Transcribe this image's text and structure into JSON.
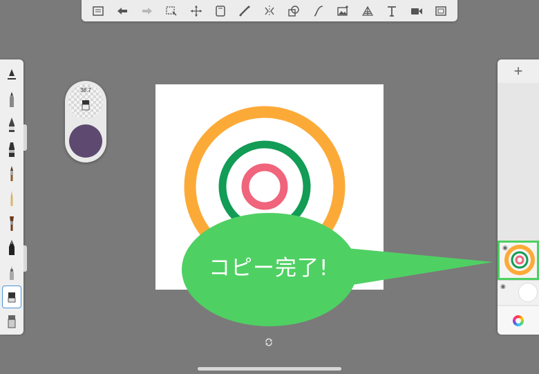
{
  "toolbar": {
    "tools": [
      {
        "name": "gallery-icon",
        "dim": false
      },
      {
        "name": "undo-icon",
        "dim": false
      },
      {
        "name": "redo-icon",
        "dim": true
      },
      {
        "name": "selection-icon",
        "dim": false
      },
      {
        "name": "transform-icon",
        "dim": false
      },
      {
        "name": "ruler-icon",
        "dim": false
      },
      {
        "name": "stroke-icon",
        "dim": false
      },
      {
        "name": "symmetry-icon",
        "dim": false
      },
      {
        "name": "shape-icon",
        "dim": false
      },
      {
        "name": "curve-icon",
        "dim": false
      },
      {
        "name": "image-icon",
        "dim": false
      },
      {
        "name": "perspective-icon",
        "dim": false
      },
      {
        "name": "text-icon",
        "dim": false
      },
      {
        "name": "video-icon",
        "dim": false
      },
      {
        "name": "fullscreen-icon",
        "dim": false
      }
    ]
  },
  "brushes": [
    "airbrush",
    "pencil",
    "ballpoint",
    "marker",
    "paintbrush",
    "fine-brush",
    "flat-brush",
    "ink-pen",
    "smudge",
    "eraser",
    "fill"
  ],
  "puck": {
    "size_value": "38.7",
    "color": "#5e4a70"
  },
  "canvas": {
    "rings": {
      "outer": "#fcaa37",
      "middle": "#129c55",
      "inner": "#f0647c"
    }
  },
  "callout": {
    "text": "コピー完了!",
    "color": "#4fd063"
  },
  "layers": {
    "add_label": "+",
    "selected_border": "#4cd160"
  }
}
